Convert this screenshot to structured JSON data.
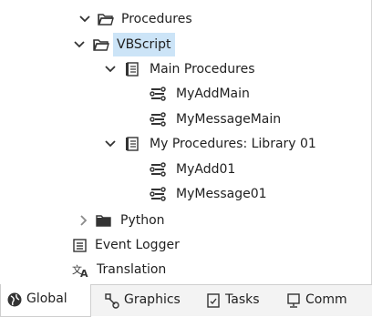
{
  "tree": {
    "procedures": "Procedures",
    "vbscript": "VBScript",
    "main_procedures": "Main Procedures",
    "my_add_main": "MyAddMain",
    "my_message_main": "MyMessageMain",
    "my_procedures_library": "My Procedures: Library 01",
    "my_add_01": "MyAdd01",
    "my_message_01": "MyMessage01",
    "python": "Python",
    "event_logger": "Event Logger",
    "translation": "Translation"
  },
  "tabs": [
    {
      "label": "Global",
      "icon": "globe-icon"
    },
    {
      "label": "Graphics",
      "icon": "graphics-icon"
    },
    {
      "label": "Tasks",
      "icon": "tasks-icon"
    },
    {
      "label": "Comm",
      "icon": "monitor-icon"
    }
  ],
  "colors": {
    "selection": "#cce4f7",
    "tab_bar": "#f3f3f3",
    "icon": "#333333"
  }
}
